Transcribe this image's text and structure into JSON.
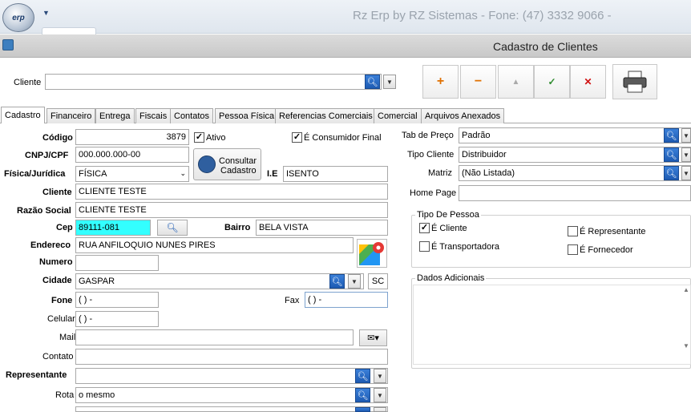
{
  "app": {
    "title": "Rz Erp by RZ Sistemas - Fone: (47) 3332 9066 -",
    "logo_text": "erp"
  },
  "window": {
    "title": "Cadastro de Clientes"
  },
  "search": {
    "label": "Cliente",
    "value": ""
  },
  "toolbar": {
    "add": "+",
    "remove": "−",
    "up": "▲",
    "confirm": "✓",
    "cancel": "✕"
  },
  "tabs": [
    "Cadastro",
    "Financeiro",
    "Entrega",
    "Fiscais",
    "Contatos",
    "Pessoa Física",
    "Referencias Comerciais",
    "Comercial",
    "Arquivos Anexados"
  ],
  "form": {
    "codigo_label": "Código",
    "codigo": "3879",
    "ativo_label": "Ativo",
    "ativo": true,
    "consumidor_label": "É Consumidor Final",
    "consumidor": true,
    "cnpj_label": "CNPJ/CPF",
    "cnpj": "000.000.000-00",
    "consultar_label_1": "Consultar",
    "consultar_label_2": "Cadastro",
    "fisjur_label": "Física/Jurídica",
    "fisjur": "FÍSICA",
    "ie_label": "I.E",
    "ie": "ISENTO",
    "cliente_label": "Cliente",
    "cliente": "CLIENTE TESTE",
    "razao_label": "Razão Social",
    "razao": "CLIENTE TESTE",
    "cep_label": "Cep",
    "cep": "89111-081",
    "bairro_label": "Bairro",
    "bairro": "BELA VISTA",
    "endereco_label": "Endereco",
    "endereco": "RUA ANFILOQUIO NUNES PIRES",
    "numero_label": "Numero",
    "numero": "",
    "cidade_label": "Cidade",
    "cidade": "GASPAR",
    "uf": "SC",
    "fone_label": "Fone",
    "fone": "(  )    -",
    "fax_label": "Fax",
    "fax": "(  )    -",
    "celular_label": "Celular",
    "celular": "(  )    -",
    "mail_label": "Mail",
    "mail": "",
    "contato_label": "Contato",
    "contato": "",
    "representante_label": "Representante",
    "representante": "",
    "rota_label": "Rota",
    "rota": "o mesmo",
    "tabpreco_label": "Tab de Preço",
    "tabpreco": "Padrão",
    "tipocliente_label": "Tipo Cliente",
    "tipocliente": "Distribuidor",
    "matriz_label": "Matriz",
    "matriz": "(Não Listada)",
    "homepage_label": "Home Page",
    "homepage": ""
  },
  "tipo_pessoa": {
    "title": "Tipo De Pessoa",
    "cliente_label": "É Cliente",
    "cliente": true,
    "transportadora_label": "É Transportadora",
    "transportadora": false,
    "representante_label": "É Representante",
    "representante": false,
    "fornecedor_label": "É Fornecedor",
    "fornecedor": false
  },
  "dados_adicionais": {
    "title": "Dados Adicionais",
    "value": ""
  },
  "colors": {
    "cep_highlight": "#33ffff",
    "add": "#e07000",
    "remove": "#e07000",
    "confirm": "#2e8b2e",
    "cancel": "#d01010"
  }
}
